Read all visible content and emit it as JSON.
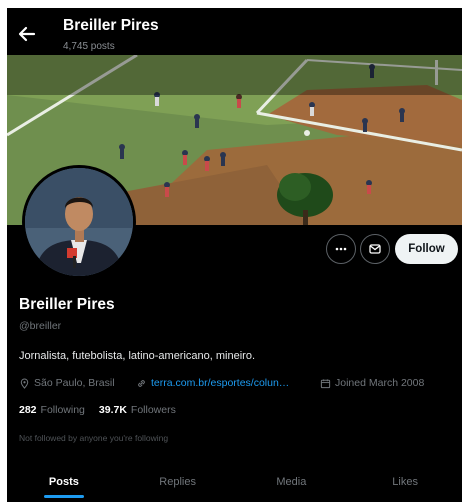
{
  "header": {
    "name": "Breiller Pires",
    "post_count": "4,745 posts"
  },
  "actions": {
    "follow_label": "Follow"
  },
  "profile": {
    "name": "Breiller Pires",
    "handle": "@breiller",
    "bio": "Jornalista, futebolista, latino-americano, mineiro.",
    "location": "São Paulo, Brasil",
    "website": "terra.com.br/esportes/colun…",
    "joined": "Joined March 2008",
    "following_count": "282",
    "following_label": "Following",
    "followers_count": "39.7K",
    "followers_label": "Followers",
    "not_followed_note": "Not followed by anyone you're following"
  },
  "tabs": [
    {
      "label": "Posts",
      "active": true
    },
    {
      "label": "Replies",
      "active": false
    },
    {
      "label": "Media",
      "active": false
    },
    {
      "label": "Likes",
      "active": false
    }
  ],
  "colors": {
    "accent": "#1d9bf0",
    "background": "#000000",
    "follow_bg": "#eff3f4"
  },
  "icons": [
    "back-arrow-icon",
    "more-icon",
    "message-icon",
    "location-icon",
    "link-icon",
    "calendar-icon"
  ]
}
